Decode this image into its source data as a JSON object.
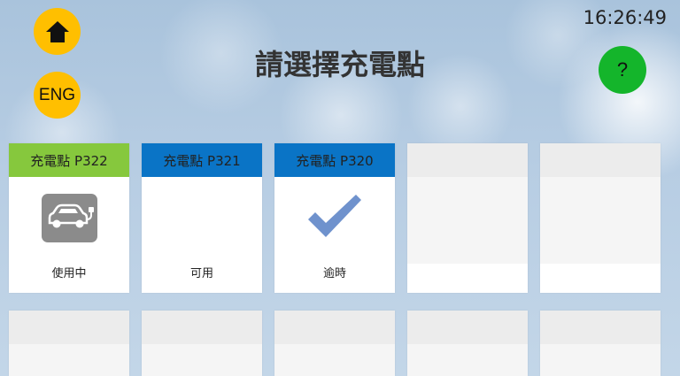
{
  "header": {
    "title": "請選擇充電點",
    "clock": "16:26:49",
    "lang_label": "ENG",
    "help_label": "?"
  },
  "colors": {
    "home_button": "#ffbf00",
    "lang_button": "#ffbf00",
    "help_button": "#14b52b",
    "status_in_use": "#86c83d",
    "status_available": "#0a74c6",
    "status_timeout": "#0a74c6"
  },
  "stations": [
    {
      "label": "充電點 P322",
      "status": "使用中",
      "icon": "ev-charging-car-icon"
    },
    {
      "label": "充電點 P321",
      "status": "可用",
      "icon": ""
    },
    {
      "label": "充電點 P320",
      "status": "逾時",
      "icon": "checkmark-icon"
    }
  ]
}
